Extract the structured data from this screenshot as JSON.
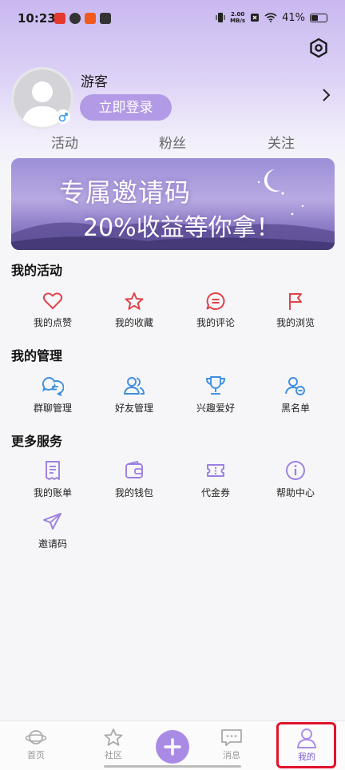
{
  "status_bar": {
    "time": "10:23",
    "net_speed_top": "2.00",
    "net_speed_bottom": "MB/s",
    "battery": "41%",
    "battery_level": 0.41
  },
  "profile": {
    "username": "游客",
    "login_label": "立即登录"
  },
  "stats": [
    "活动",
    "粉丝",
    "关注"
  ],
  "banner": {
    "line1": "专属邀请码",
    "line2": "20%收益等你拿！"
  },
  "sections": {
    "activity": {
      "title": "我的活动",
      "items": [
        {
          "label": "我的点赞",
          "icon": "heart-icon"
        },
        {
          "label": "我的收藏",
          "icon": "star-icon"
        },
        {
          "label": "我的评论",
          "icon": "comment-icon"
        },
        {
          "label": "我的浏览",
          "icon": "flag-icon"
        }
      ]
    },
    "management": {
      "title": "我的管理",
      "items": [
        {
          "label": "群聊管理",
          "icon": "group-chat-icon"
        },
        {
          "label": "好友管理",
          "icon": "friends-icon"
        },
        {
          "label": "兴趣爱好",
          "icon": "trophy-icon"
        },
        {
          "label": "黑名单",
          "icon": "blocked-user-icon"
        }
      ]
    },
    "services": {
      "title": "更多服务",
      "items": [
        {
          "label": "我的账单",
          "icon": "bill-icon"
        },
        {
          "label": "我的钱包",
          "icon": "wallet-icon"
        },
        {
          "label": "代金券",
          "icon": "coupon-icon"
        },
        {
          "label": "帮助中心",
          "icon": "help-icon"
        },
        {
          "label": "邀请码",
          "icon": "send-icon"
        }
      ]
    }
  },
  "bottom_nav": {
    "items": [
      {
        "label": "首页",
        "icon": "planet-icon"
      },
      {
        "label": "社区",
        "icon": "star-icon"
      },
      {
        "label": "",
        "icon": "plus-icon"
      },
      {
        "label": "消息",
        "icon": "message-icon"
      },
      {
        "label": "我的",
        "icon": "user-icon",
        "active": true
      }
    ]
  },
  "colors": {
    "activity_red": "#e0434a",
    "management_blue": "#3f8fe0",
    "services_purple": "#9b7fe0",
    "accent": "#a98be6",
    "highlight_red": "#e0142a"
  }
}
